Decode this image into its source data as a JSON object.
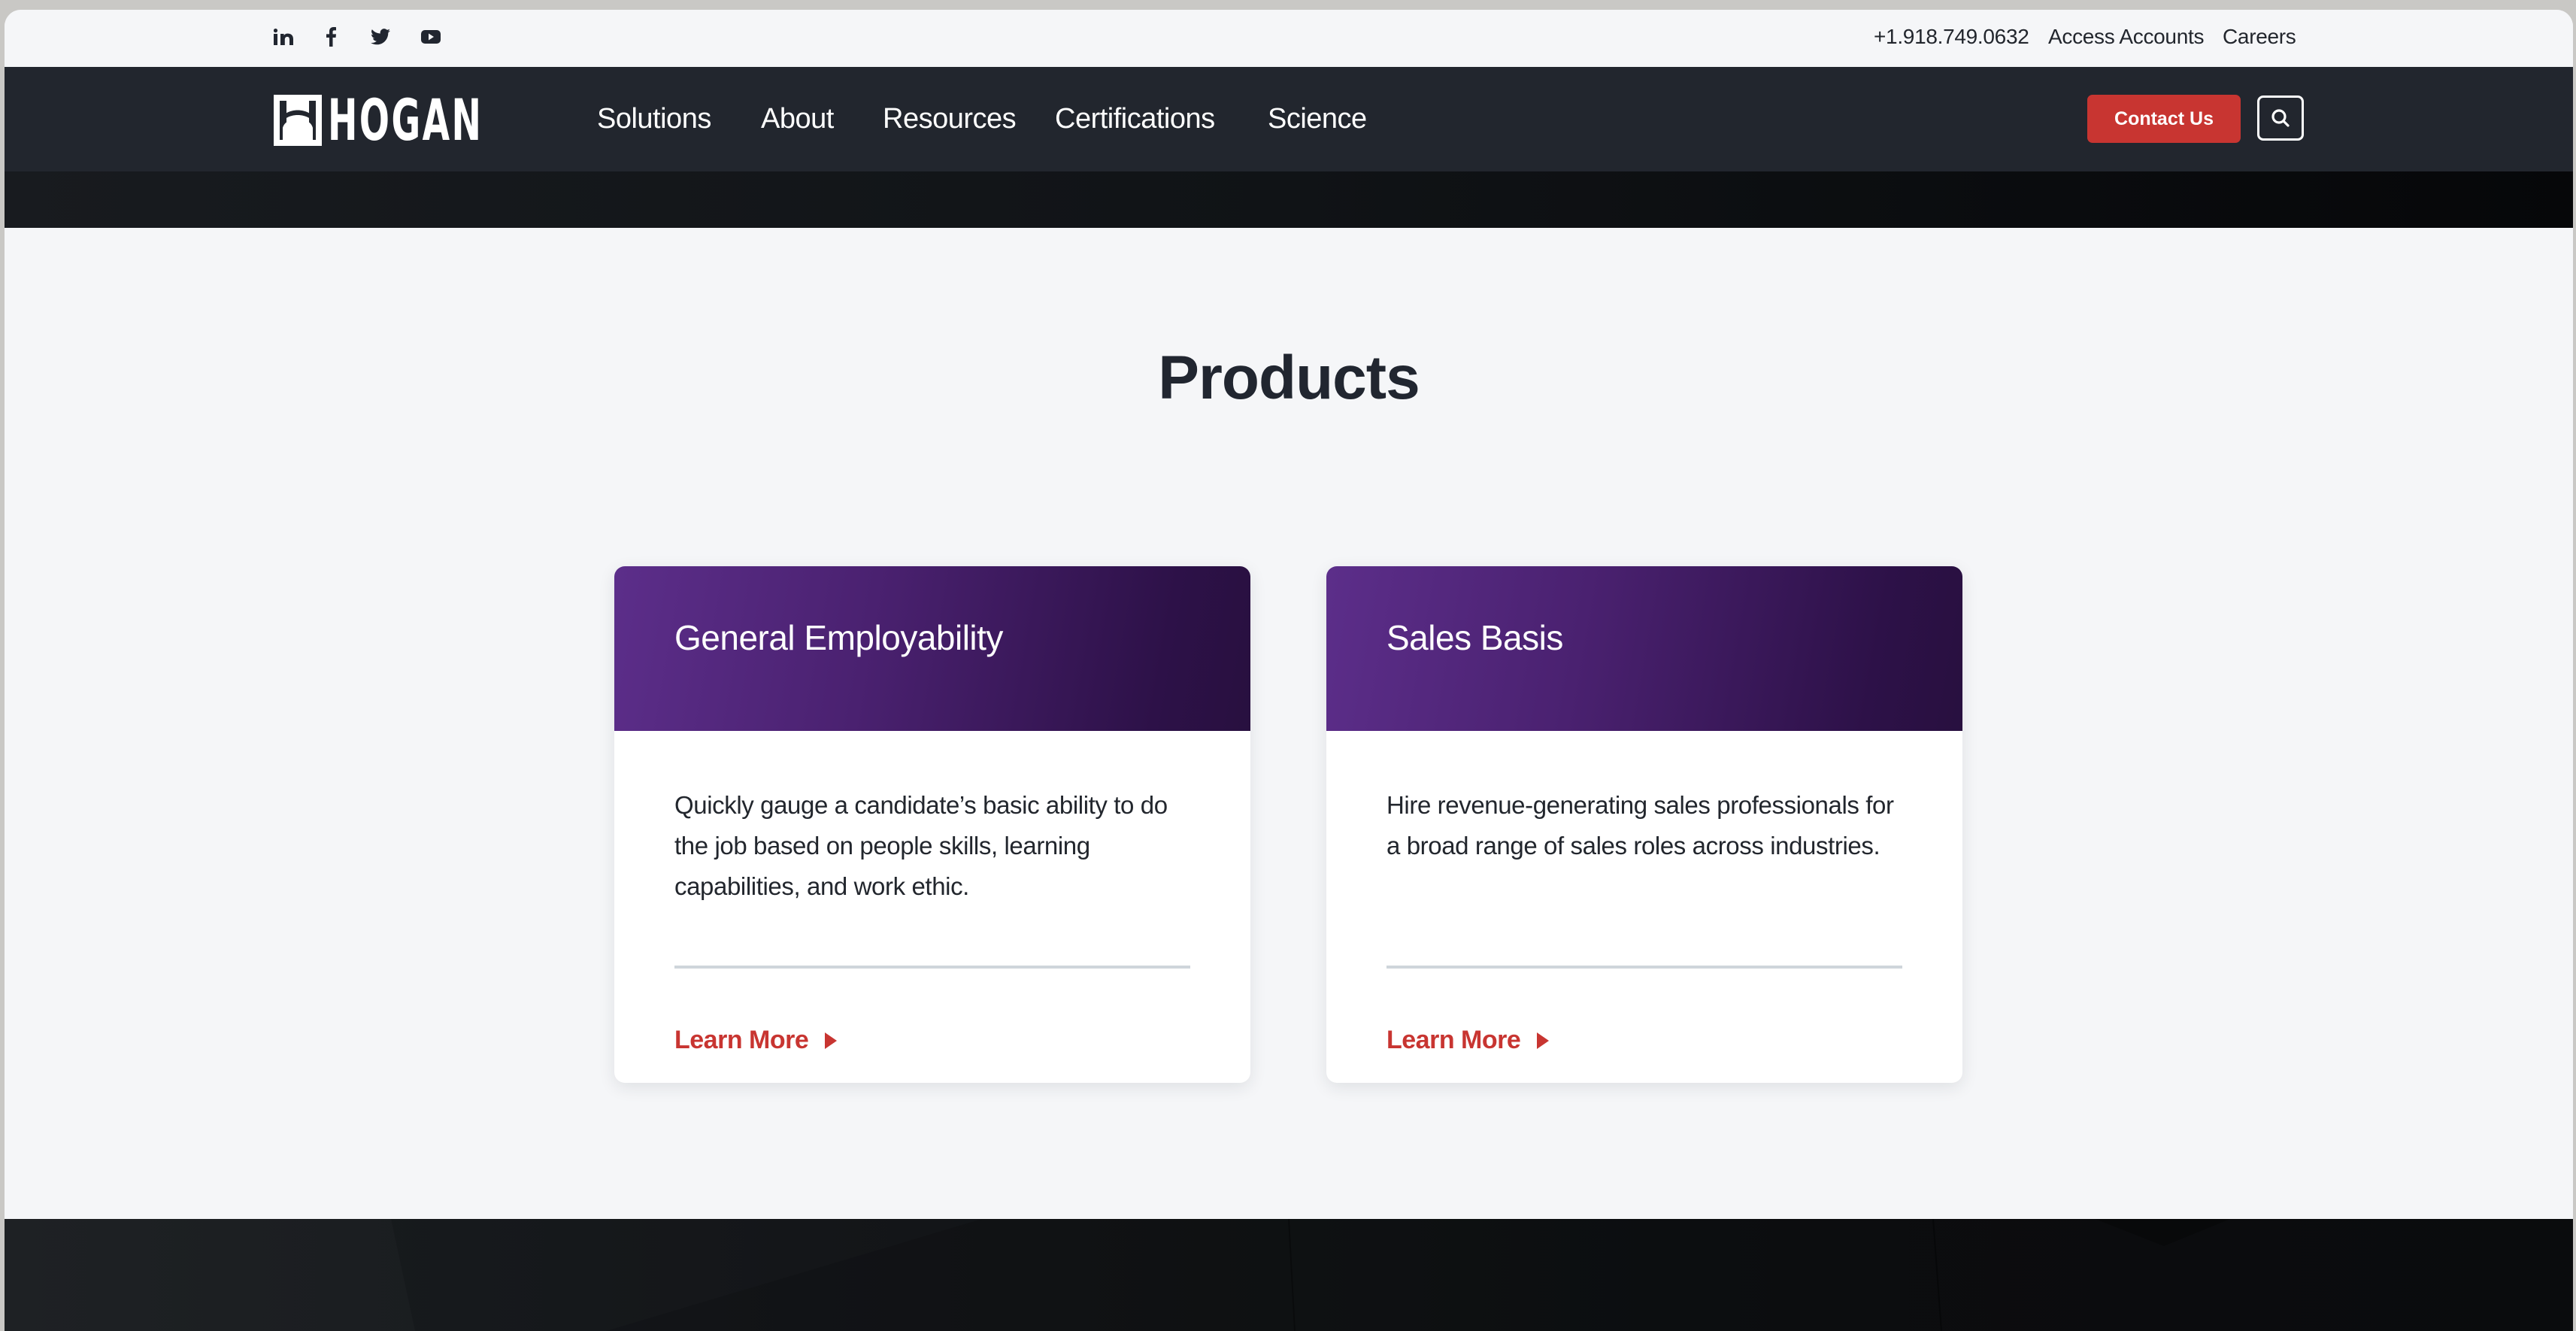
{
  "topbar": {
    "social": [
      {
        "name": "linkedin-icon",
        "label": "LinkedIn"
      },
      {
        "name": "facebook-icon",
        "label": "Facebook"
      },
      {
        "name": "twitter-icon",
        "label": "Twitter"
      },
      {
        "name": "youtube-icon",
        "label": "YouTube"
      }
    ],
    "phone": "+1.918.749.0632",
    "access_accounts": "Access Accounts",
    "careers": "Careers"
  },
  "nav": {
    "logo_text": "HOGAN",
    "items": [
      {
        "label": "Solutions"
      },
      {
        "label": "About"
      },
      {
        "label": "Resources"
      },
      {
        "label": "Certifications"
      },
      {
        "label": "Science"
      }
    ],
    "contact_label": "Contact Us",
    "search_icon": "search-icon"
  },
  "products": {
    "title": "Products",
    "cards": [
      {
        "title": "General Employability",
        "description": "Quickly gauge a candidate’s basic ability to do the job based on people skills, learning capabilities, and work ethic.",
        "link_label": "Learn More"
      },
      {
        "title": "Sales Basis",
        "description": "Hire revenue-generating sales professionals for a broad range of sales roles across industries.",
        "link_label": "Learn More"
      }
    ]
  },
  "colors": {
    "nav_bg": "#22262e",
    "accent_red": "#c83531",
    "card_purple_start": "#5c2e8a",
    "card_purple_end": "#28103f",
    "page_bg": "#f5f6f8",
    "text_dark": "#212630"
  }
}
